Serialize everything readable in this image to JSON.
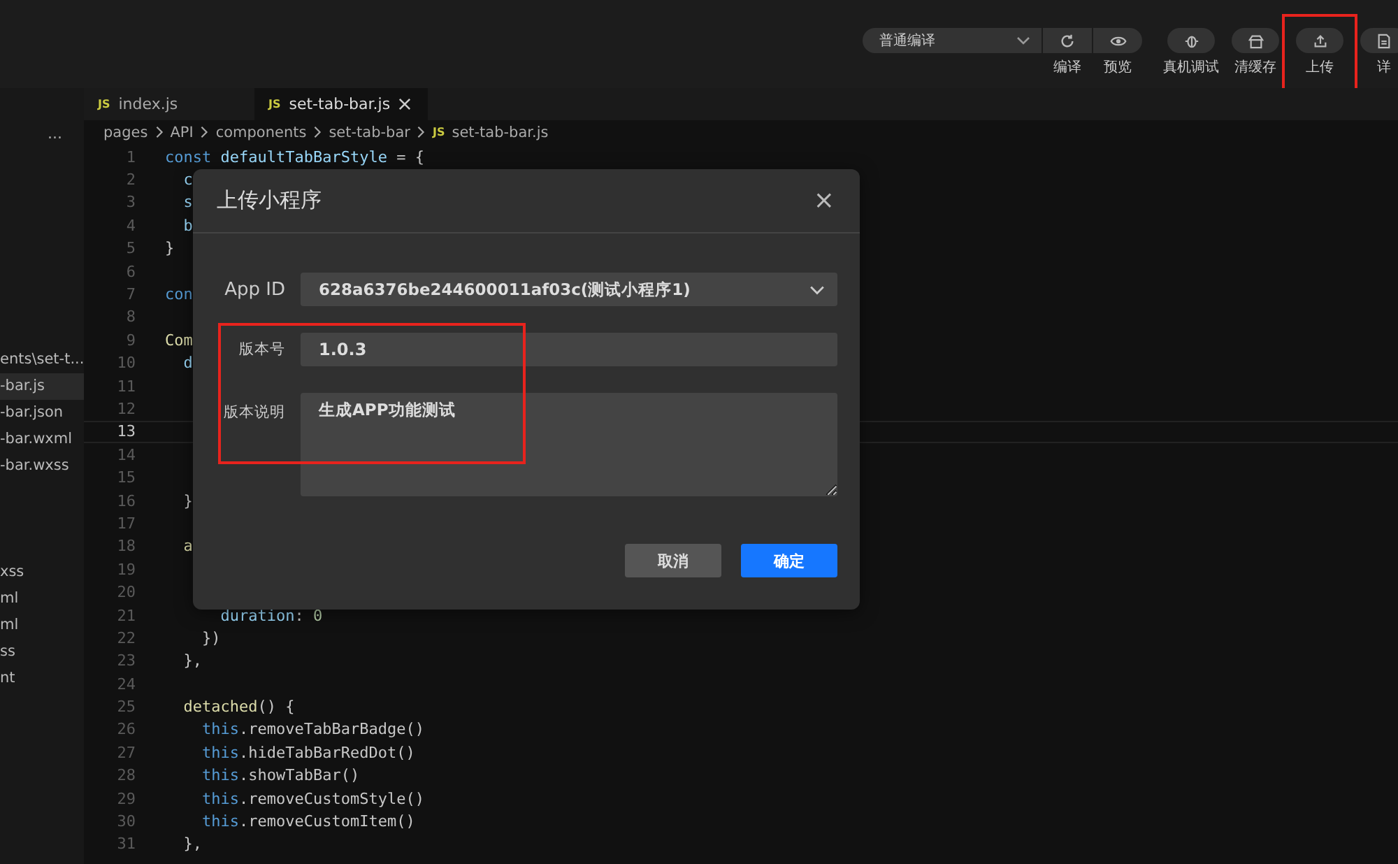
{
  "toolbar": {
    "mode_select": {
      "value": "普通编译"
    },
    "buttons": [
      {
        "label": "编译",
        "highlighted": false
      },
      {
        "label": "预览",
        "highlighted": false
      },
      {
        "label": "真机调试",
        "highlighted": false
      },
      {
        "label": "清缓存",
        "highlighted": false
      },
      {
        "label": "上传",
        "highlighted": true
      },
      {
        "label": "详",
        "highlighted": false
      }
    ]
  },
  "sidebar": {
    "more": "...",
    "groups": [
      {
        "items": [
          {
            "label": "ents\\set-t...",
            "selected": false
          },
          {
            "label": "-bar.js",
            "selected": true
          },
          {
            "label": "-bar.json",
            "selected": false
          },
          {
            "label": "-bar.wxml",
            "selected": false
          },
          {
            "label": "-bar.wxss",
            "selected": false
          }
        ]
      },
      {
        "items": [
          {
            "label": "xss",
            "selected": false
          },
          {
            "label": "ml",
            "selected": false
          },
          {
            "label": "ml",
            "selected": false
          },
          {
            "label": "ss",
            "selected": false
          },
          {
            "label": "nt",
            "selected": false
          }
        ]
      }
    ]
  },
  "tabs": [
    {
      "badge": "JS",
      "label": "index.js",
      "selected": false,
      "closable": false
    },
    {
      "badge": "JS",
      "label": "set-tab-bar.js",
      "selected": true,
      "closable": true
    }
  ],
  "breadcrumb": {
    "parts": [
      "pages",
      "API",
      "components",
      "set-tab-bar"
    ],
    "file_badge": "JS",
    "file": "set-tab-bar.js"
  },
  "code": {
    "lines": [
      {
        "number": "1",
        "current": false,
        "tokens": [
          {
            "t": "const",
            "kind": "kw"
          },
          {
            "t": " defaultTabBarStyle",
            "kind": "var"
          },
          {
            "t": " = {",
            "kind": "plain"
          }
        ]
      },
      {
        "number": "2",
        "current": false,
        "tokens": [
          {
            "t": "  c",
            "kind": "var"
          }
        ]
      },
      {
        "number": "3",
        "current": false,
        "tokens": [
          {
            "t": "  s",
            "kind": "var"
          }
        ]
      },
      {
        "number": "4",
        "current": false,
        "tokens": [
          {
            "t": "  b",
            "kind": "var"
          }
        ]
      },
      {
        "number": "5",
        "current": false,
        "tokens": [
          {
            "t": "}",
            "kind": "plain"
          }
        ]
      },
      {
        "number": "6",
        "current": false
      },
      {
        "number": "7",
        "current": false,
        "tokens": [
          {
            "t": "con",
            "kind": "kw"
          }
        ]
      },
      {
        "number": "8",
        "current": false
      },
      {
        "number": "9",
        "current": false,
        "tokens": [
          {
            "t": "Com",
            "kind": "fn"
          }
        ]
      },
      {
        "number": "10",
        "current": false,
        "tokens": [
          {
            "t": "  d",
            "kind": "var"
          }
        ]
      },
      {
        "number": "11",
        "current": false
      },
      {
        "number": "12",
        "current": false
      },
      {
        "number": "13",
        "current": true
      },
      {
        "number": "14",
        "current": false
      },
      {
        "number": "15",
        "current": false
      },
      {
        "number": "16",
        "current": false,
        "tokens": [
          {
            "t": "  }",
            "kind": "plain"
          }
        ]
      },
      {
        "number": "17",
        "current": false
      },
      {
        "number": "18",
        "current": false,
        "tokens": [
          {
            "t": "  a",
            "kind": "fn"
          }
        ]
      },
      {
        "number": "19",
        "current": false
      },
      {
        "number": "20",
        "current": false
      },
      {
        "number": "21",
        "current": false,
        "tokens": [
          {
            "t": "      duration",
            "kind": "var"
          },
          {
            "t": ": ",
            "kind": "plain"
          },
          {
            "t": "0",
            "kind": "num"
          }
        ]
      },
      {
        "number": "22",
        "current": false,
        "tokens": [
          {
            "t": "    })",
            "kind": "plain"
          }
        ]
      },
      {
        "number": "23",
        "current": false,
        "tokens": [
          {
            "t": "  },",
            "kind": "plain"
          }
        ]
      },
      {
        "number": "24",
        "current": false
      },
      {
        "number": "25",
        "current": false,
        "tokens": [
          {
            "t": "  detached",
            "kind": "fn"
          },
          {
            "t": "() {",
            "kind": "plain"
          }
        ]
      },
      {
        "number": "26",
        "current": false,
        "tokens": [
          {
            "t": "    this",
            "kind": "kw"
          },
          {
            "t": ".removeTabBarBadge()",
            "kind": "plain"
          }
        ]
      },
      {
        "number": "27",
        "current": false,
        "tokens": [
          {
            "t": "    this",
            "kind": "kw"
          },
          {
            "t": ".hideTabBarRedDot()",
            "kind": "plain"
          }
        ]
      },
      {
        "number": "28",
        "current": false,
        "tokens": [
          {
            "t": "    this",
            "kind": "kw"
          },
          {
            "t": ".showTabBar()",
            "kind": "plain"
          }
        ]
      },
      {
        "number": "29",
        "current": false,
        "tokens": [
          {
            "t": "    this",
            "kind": "kw"
          },
          {
            "t": ".removeCustomStyle()",
            "kind": "plain"
          }
        ]
      },
      {
        "number": "30",
        "current": false,
        "tokens": [
          {
            "t": "    this",
            "kind": "kw"
          },
          {
            "t": ".removeCustomItem()",
            "kind": "plain"
          }
        ]
      },
      {
        "number": "31",
        "current": false,
        "tokens": [
          {
            "t": "  },",
            "kind": "plain"
          }
        ]
      }
    ]
  },
  "dialog": {
    "title": "上传小程序",
    "close": "×",
    "highlight_version_fields": true,
    "app_id": {
      "label": "App ID",
      "value": "628a6376be244600011af03c(测试小程序1)"
    },
    "version": {
      "label": "版本号",
      "value": "1.0.3"
    },
    "description": {
      "label": "版本说明",
      "value": "生成APP功能测试"
    },
    "buttons": [
      {
        "label": "取消",
        "kind": "secondary"
      },
      {
        "label": "确定",
        "kind": "primary"
      }
    ]
  }
}
